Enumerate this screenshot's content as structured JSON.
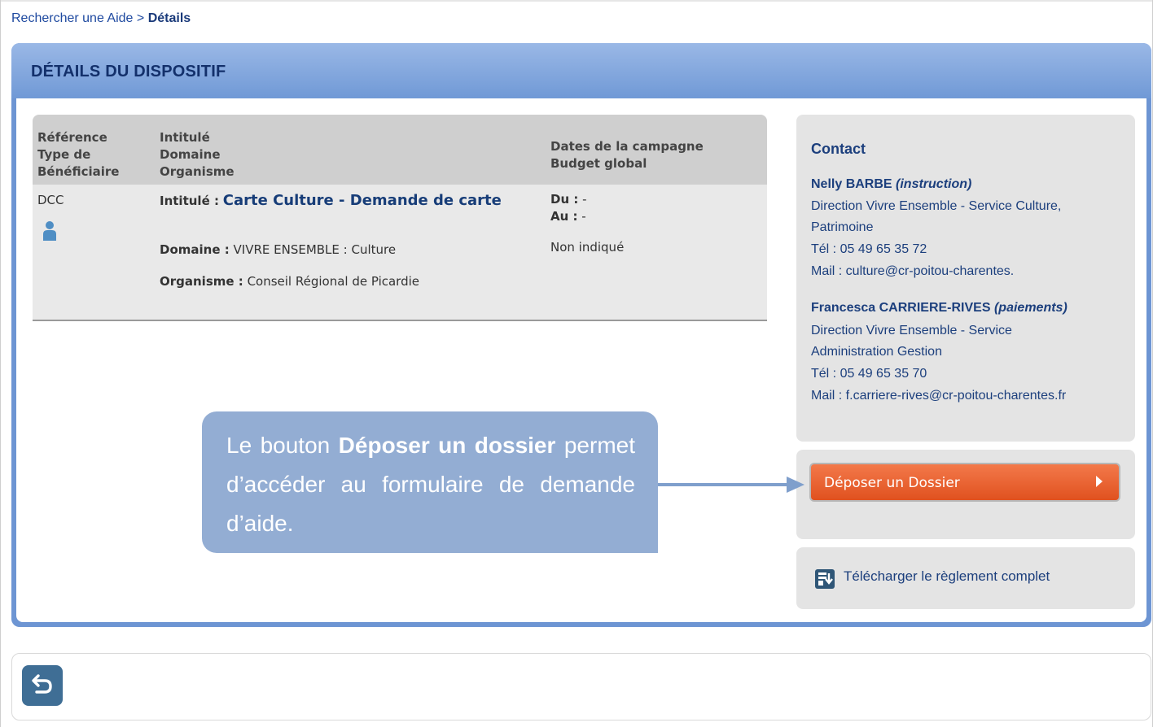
{
  "breadcrumb": {
    "parent": "Rechercher une Aide",
    "separator": ">",
    "current": "Détails"
  },
  "panel": {
    "title": "DÉTAILS DU DISPOSITIF"
  },
  "table": {
    "headers": {
      "col1": [
        "Référence",
        "Type de",
        "Bénéficiaire"
      ],
      "col2": [
        "Intitulé",
        "Domaine",
        "Organisme"
      ],
      "col3": [
        "Dates de la campagne",
        "Budget global"
      ]
    },
    "row": {
      "reference": "DCC",
      "intitule_label": "Intitulé :",
      "intitule_value": "Carte Culture - Demande de carte",
      "domaine_label": "Domaine :",
      "domaine_value": "VIVRE ENSEMBLE : Culture",
      "organisme_label": "Organisme :",
      "organisme_value": "Conseil Régional de Picardie",
      "du_label": "Du :",
      "du_value": "-",
      "au_label": "Au :",
      "au_value": "-",
      "budget": "Non indiqué"
    }
  },
  "contact": {
    "title": "Contact",
    "persons": [
      {
        "name": "Nelly BARBE",
        "role": "(instruction)",
        "service1": "Direction Vivre Ensemble - Service Culture,",
        "service2": "Patrimoine",
        "tel": "Tél : 05 49 65 35 72",
        "mail": "Mail : culture@cr-poitou-charentes."
      },
      {
        "name": "Francesca CARRIERE-RIVES",
        "role": "(paiements)",
        "service1": "Direction Vivre Ensemble - Service",
        "service2": "Administration Gestion",
        "tel": "Tél : 05 49 65 35 70",
        "mail": "Mail : f.carriere-rives@cr-poitou-charentes.fr"
      }
    ]
  },
  "actions": {
    "depose_label": "Déposer un Dossier",
    "download_label": "Télécharger le règlement complet"
  },
  "callout": {
    "before": "Le bouton ",
    "bold": "Déposer un dossier",
    "after": " permet d’accéder au formulaire de demande d’aide."
  },
  "colors": {
    "panel_blue": "#6d95d3",
    "orange": "#e8602b",
    "callout": "#93add3",
    "back_button": "#3f6e95"
  }
}
